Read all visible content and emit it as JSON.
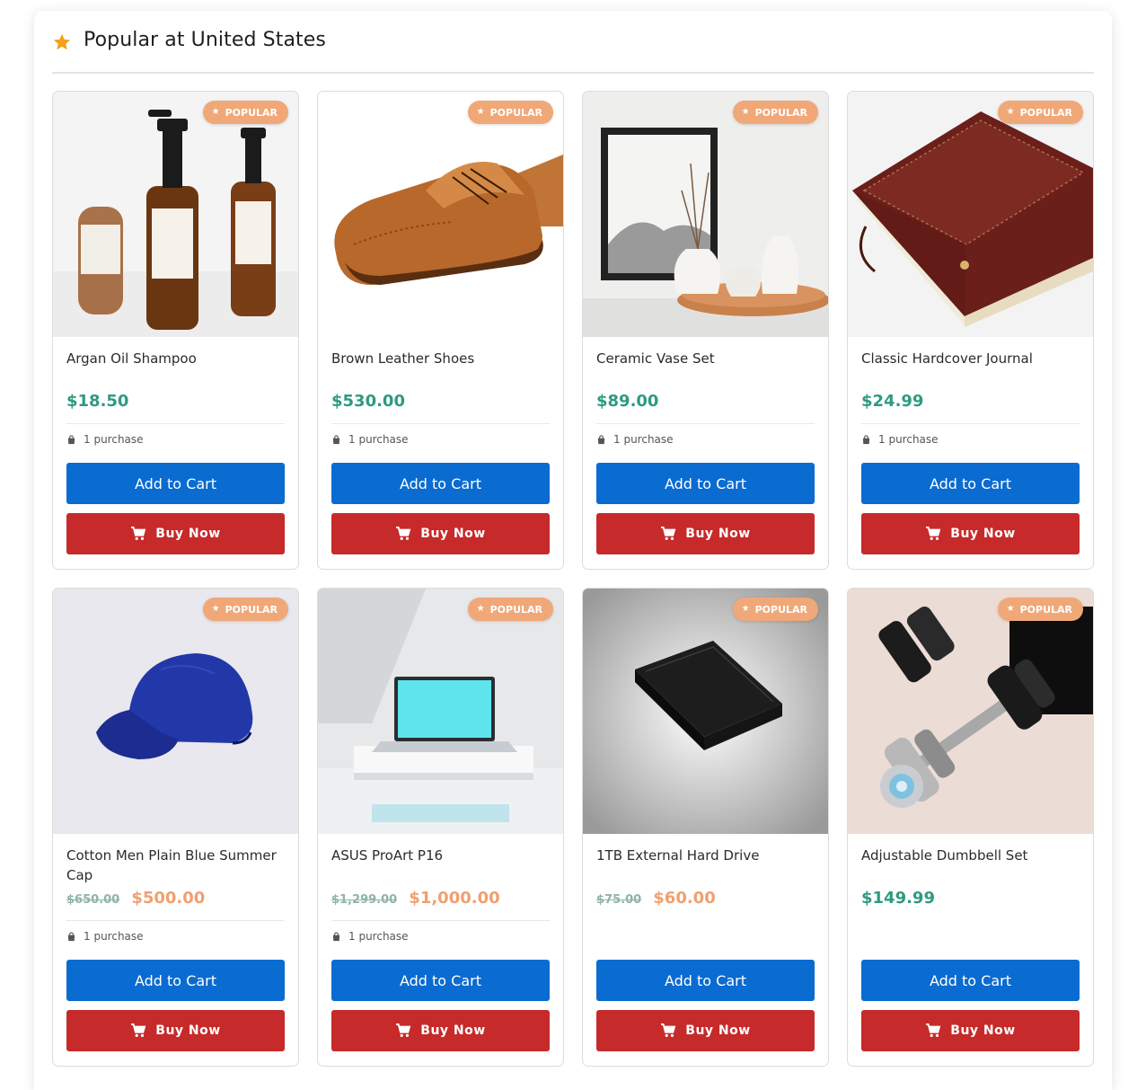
{
  "section": {
    "title": "Popular at United States"
  },
  "products": [
    {
      "name": "Argan Oil Shampoo",
      "price": "$18.50",
      "old_price": "",
      "sale": false,
      "purchases": "1 purchase",
      "badge": "POPULAR",
      "add_label": "Add to Cart",
      "buy_label": "Buy Now",
      "image": "argan-oil-bottles"
    },
    {
      "name": "Brown Leather Shoes",
      "price": "$530.00",
      "old_price": "",
      "sale": false,
      "purchases": "1 purchase",
      "badge": "POPULAR",
      "add_label": "Add to Cart",
      "buy_label": "Buy Now",
      "image": "brown-brogue-shoe"
    },
    {
      "name": "Ceramic Vase Set",
      "price": "$89.00",
      "old_price": "",
      "sale": false,
      "purchases": "1 purchase",
      "badge": "POPULAR",
      "add_label": "Add to Cart",
      "buy_label": "Buy Now",
      "image": "white-vases-on-tray"
    },
    {
      "name": "Classic Hardcover Journal",
      "price": "$24.99",
      "old_price": "",
      "sale": false,
      "purchases": "1 purchase",
      "badge": "POPULAR",
      "add_label": "Add to Cart",
      "buy_label": "Buy Now",
      "image": "leather-journal"
    },
    {
      "name": "Cotton Men Plain Blue Summer Cap",
      "price": "$500.00",
      "old_price": "$650.00",
      "sale": true,
      "purchases": "1 purchase",
      "badge": "POPULAR",
      "add_label": "Add to Cart",
      "buy_label": "Buy Now",
      "image": "blue-baseball-cap"
    },
    {
      "name": "ASUS ProArt P16",
      "price": "$1,000.00",
      "old_price": "$1,299.00",
      "sale": true,
      "purchases": "1 purchase",
      "badge": "POPULAR",
      "add_label": "Add to Cart",
      "buy_label": "Buy Now",
      "image": "laptop-on-stand"
    },
    {
      "name": "1TB External Hard Drive",
      "price": "$60.00",
      "old_price": "$75.00",
      "sale": true,
      "purchases": "",
      "badge": "POPULAR",
      "add_label": "Add to Cart",
      "buy_label": "Buy Now",
      "image": "black-hard-drive"
    },
    {
      "name": "Adjustable Dumbbell Set",
      "price": "$149.99",
      "old_price": "",
      "sale": false,
      "purchases": "",
      "badge": "POPULAR",
      "add_label": "Add to Cart",
      "buy_label": "Buy Now",
      "image": "dumbbells"
    }
  ],
  "colors": {
    "accent_star": "#f2a01a",
    "price": "#2e9a80",
    "sale_price": "#f0a070",
    "add_to_cart": "#0a6bd1",
    "buy_now": "#c62a2a",
    "badge": "#f0a878"
  },
  "icons": {
    "header": "star-icon",
    "badge": "star-icon",
    "purchases": "shopping-bag-icon",
    "buy": "cart-icon"
  }
}
